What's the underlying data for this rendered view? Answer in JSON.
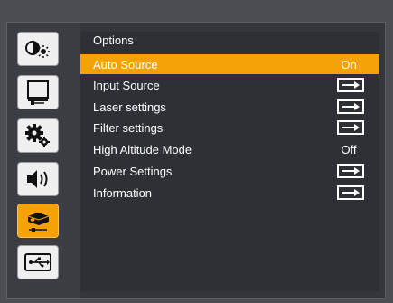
{
  "menu": {
    "title": "Options",
    "items": [
      {
        "label": "Auto Source",
        "value": "On",
        "type": "value",
        "selected": true
      },
      {
        "label": "Input Source",
        "value": "",
        "type": "submenu",
        "selected": false
      },
      {
        "label": "Laser settings",
        "value": "",
        "type": "submenu",
        "selected": false
      },
      {
        "label": "Filter settings",
        "value": "",
        "type": "submenu",
        "selected": false
      },
      {
        "label": "High Altitude Mode",
        "value": "Off",
        "type": "value",
        "selected": false
      },
      {
        "label": "Power Settings",
        "value": "",
        "type": "submenu",
        "selected": false
      },
      {
        "label": "Information",
        "value": "",
        "type": "submenu",
        "selected": false
      }
    ]
  },
  "sidebar": {
    "tabs": [
      {
        "icon": "brightness-contrast-icon",
        "active": false
      },
      {
        "icon": "screen-display-icon",
        "active": false
      },
      {
        "icon": "gears-settings-icon",
        "active": false
      },
      {
        "icon": "speaker-volume-icon",
        "active": false
      },
      {
        "icon": "projector-options-icon",
        "active": true
      },
      {
        "icon": "usb-icon",
        "active": false
      }
    ]
  },
  "colors": {
    "accent": "#f5a209",
    "background": "#2e3035",
    "text": "#ffffff"
  }
}
